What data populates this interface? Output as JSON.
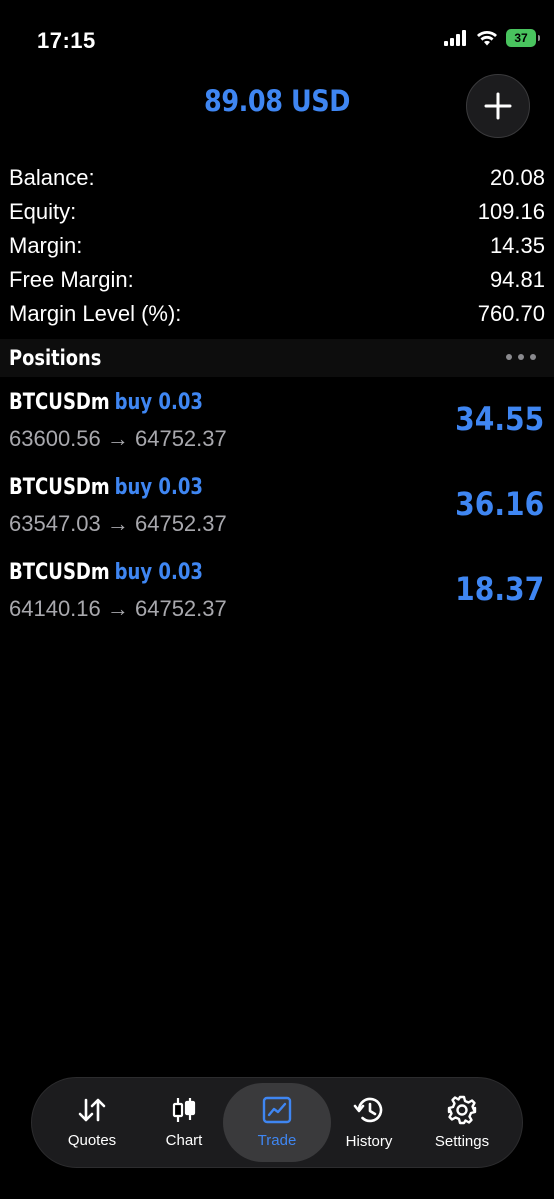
{
  "status_bar": {
    "time": "17:15",
    "battery": "37"
  },
  "header": {
    "total": "89.08 USD",
    "accent_color": "#3f86f2"
  },
  "summary": [
    {
      "label": "Balance:",
      "value": "20.08"
    },
    {
      "label": "Equity:",
      "value": "109.16"
    },
    {
      "label": "Margin:",
      "value": "14.35"
    },
    {
      "label": "Free Margin:",
      "value": "94.81"
    },
    {
      "label": "Margin Level (%):",
      "value": "760.70"
    }
  ],
  "positions": {
    "title": "Positions",
    "items": [
      {
        "symbol": "BTCUSDm",
        "type": "buy 0.03",
        "prices": "63600.56 → 64752.37",
        "profit": "34.55"
      },
      {
        "symbol": "BTCUSDm",
        "type": "buy 0.03",
        "prices": "63547.03 → 64752.37",
        "profit": "36.16"
      },
      {
        "symbol": "BTCUSDm",
        "type": "buy 0.03",
        "prices": "64140.16 → 64752.37",
        "profit": "18.37"
      }
    ]
  },
  "tabs": [
    {
      "label": "Quotes",
      "icon": "quotes-arrows-icon"
    },
    {
      "label": "Chart",
      "icon": "candlestick-icon"
    },
    {
      "label": "Trade",
      "icon": "trade-chart-icon",
      "active": true
    },
    {
      "label": "History",
      "icon": "history-icon"
    },
    {
      "label": "Settings",
      "icon": "gear-icon"
    }
  ]
}
